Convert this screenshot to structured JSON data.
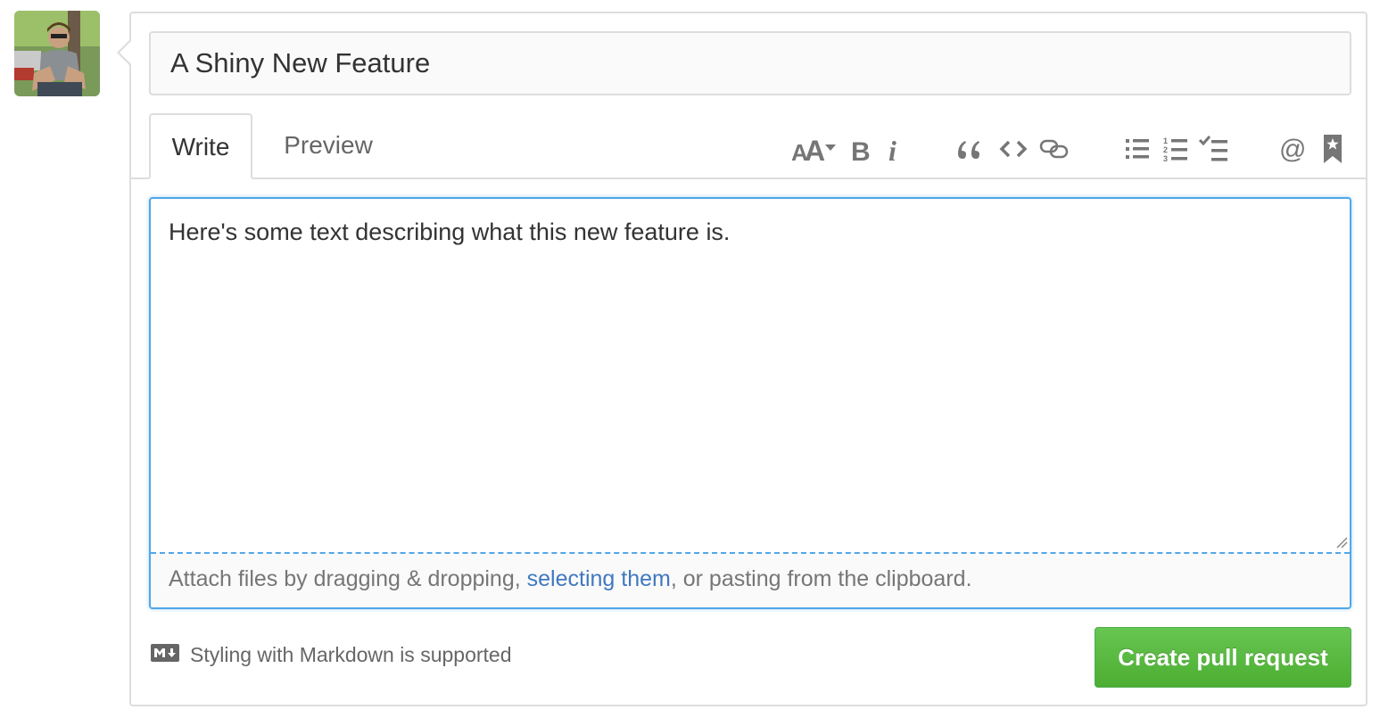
{
  "user": {
    "avatar_icon": "user-avatar-photo"
  },
  "title_field": {
    "value": "A Shiny New Feature"
  },
  "tabs": [
    {
      "label": "Write",
      "selected": true
    },
    {
      "label": "Preview",
      "selected": false
    }
  ],
  "toolbar": {
    "icons": [
      "text-size-icon",
      "bold-icon",
      "italic-icon",
      "quote-icon",
      "code-icon",
      "link-icon",
      "unordered-list-icon",
      "ordered-list-icon",
      "task-list-icon",
      "mention-icon",
      "saved-reply-icon"
    ]
  },
  "editor": {
    "body_text": "Here's some text describing what this new feature is.",
    "attach": {
      "prefix": "Attach files by dragging & dropping, ",
      "link": "selecting them",
      "suffix": ", or pasting from the clipboard."
    }
  },
  "footer": {
    "markdown_icon": "markdown-icon",
    "markdown_hint": "Styling with Markdown is supported",
    "submit_label": "Create pull request"
  },
  "colors": {
    "focus_border": "#51a7e8",
    "link": "#4078c0",
    "primary_button": "#55b23e",
    "border": "#dddddd"
  }
}
